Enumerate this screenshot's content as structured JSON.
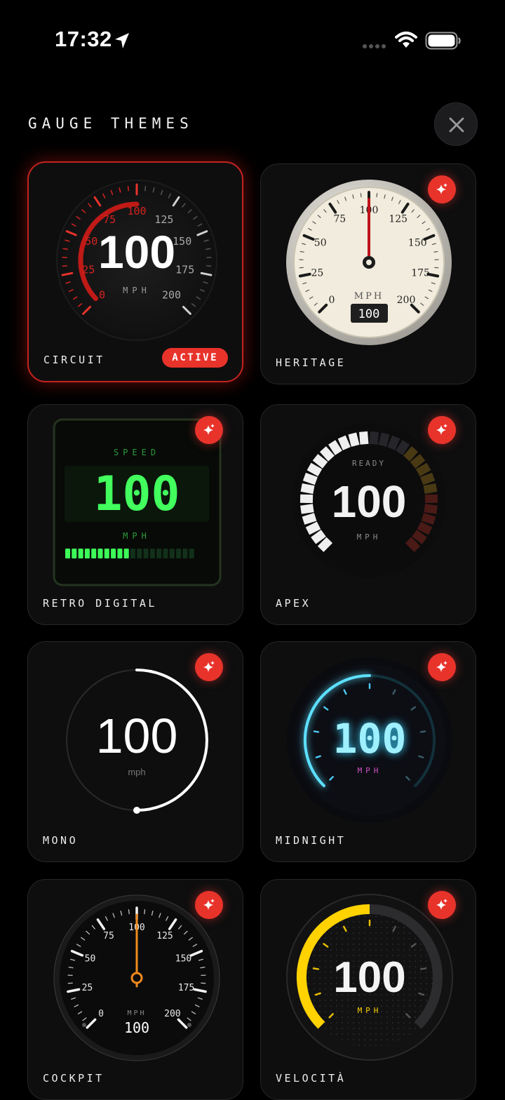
{
  "status": {
    "time": "17:32"
  },
  "header": {
    "title": "GAUGE THEMES"
  },
  "themes": {
    "circuit": {
      "name": "CIRCUIT",
      "badge": "ACTIVE",
      "speed": "100",
      "unit": "MPH",
      "ticks": [
        "0",
        "25",
        "50",
        "75",
        "100",
        "125",
        "150",
        "175",
        "200"
      ]
    },
    "heritage": {
      "name": "HERITAGE",
      "speed": "100",
      "unit": "MPH",
      "ticks": [
        "0",
        "25",
        "50",
        "75",
        "100",
        "125",
        "150",
        "175",
        "200"
      ]
    },
    "retro": {
      "name": "RETRO DIGITAL",
      "speed": "100",
      "top": "SPEED",
      "unit": "MPH"
    },
    "apex": {
      "name": "APEX",
      "speed": "100",
      "top": "READY",
      "unit": "MPH"
    },
    "mono": {
      "name": "MONO",
      "speed": "100",
      "unit": "mph"
    },
    "midnight": {
      "name": "MIDNIGHT",
      "speed": "100",
      "unit": "MPH"
    },
    "cockpit": {
      "name": "COCKPIT",
      "speed": "100",
      "unit": "MPH",
      "ticks": [
        "0",
        "25",
        "50",
        "75",
        "100",
        "125",
        "150",
        "175",
        "200"
      ]
    },
    "velocita": {
      "name": "VELOCITÀ",
      "speed": "100",
      "unit": "MPH"
    }
  },
  "colors": {
    "accent": "#e8332b",
    "background": "#000000",
    "card": "#0e0e0f",
    "retro_green": "#39ff55",
    "midnight_cyan": "#5de0ff",
    "velocita_yellow": "#ffd200",
    "cockpit_needle": "#f08a1c"
  }
}
